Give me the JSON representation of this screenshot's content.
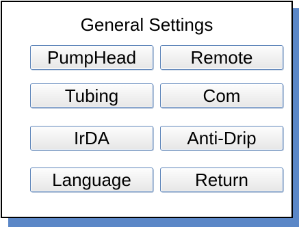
{
  "dialog": {
    "title": "General Settings",
    "buttons": [
      {
        "label": "PumpHead"
      },
      {
        "label": "Remote"
      },
      {
        "label": "Tubing"
      },
      {
        "label": "Com"
      },
      {
        "label": "IrDA"
      },
      {
        "label": "Anti-Drip"
      },
      {
        "label": "Language"
      },
      {
        "label": "Return"
      }
    ]
  },
  "colors": {
    "shadow": "#5b87c7",
    "button_border": "#5a82b8",
    "panel_border": "#000000"
  }
}
